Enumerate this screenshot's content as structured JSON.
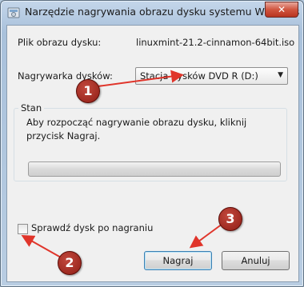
{
  "window": {
    "title": "Narzędzie nagrywania obrazu dysku systemu Windows",
    "close_glyph": "✕"
  },
  "disc_image": {
    "label": "Plik obrazu dysku:",
    "value": "linuxmint-21.2-cinnamon-64bit.iso"
  },
  "burner": {
    "label": "Nagrywarka dysków:",
    "selected": "Stacja dysków DVD R (D:)"
  },
  "status": {
    "title": "Stan",
    "text": "Aby rozpocząć nagrywanie obrazu dysku, kliknij przycisk Nagraj.",
    "progress": 0
  },
  "verify": {
    "label": "Sprawdź dysk po nagraniu",
    "checked": false
  },
  "buttons": {
    "burn": "Nagraj",
    "cancel": "Anuluj"
  },
  "callouts": [
    "1",
    "2",
    "3"
  ],
  "colors": {
    "callout": "#a8291f",
    "arrow": "#e0352b"
  }
}
